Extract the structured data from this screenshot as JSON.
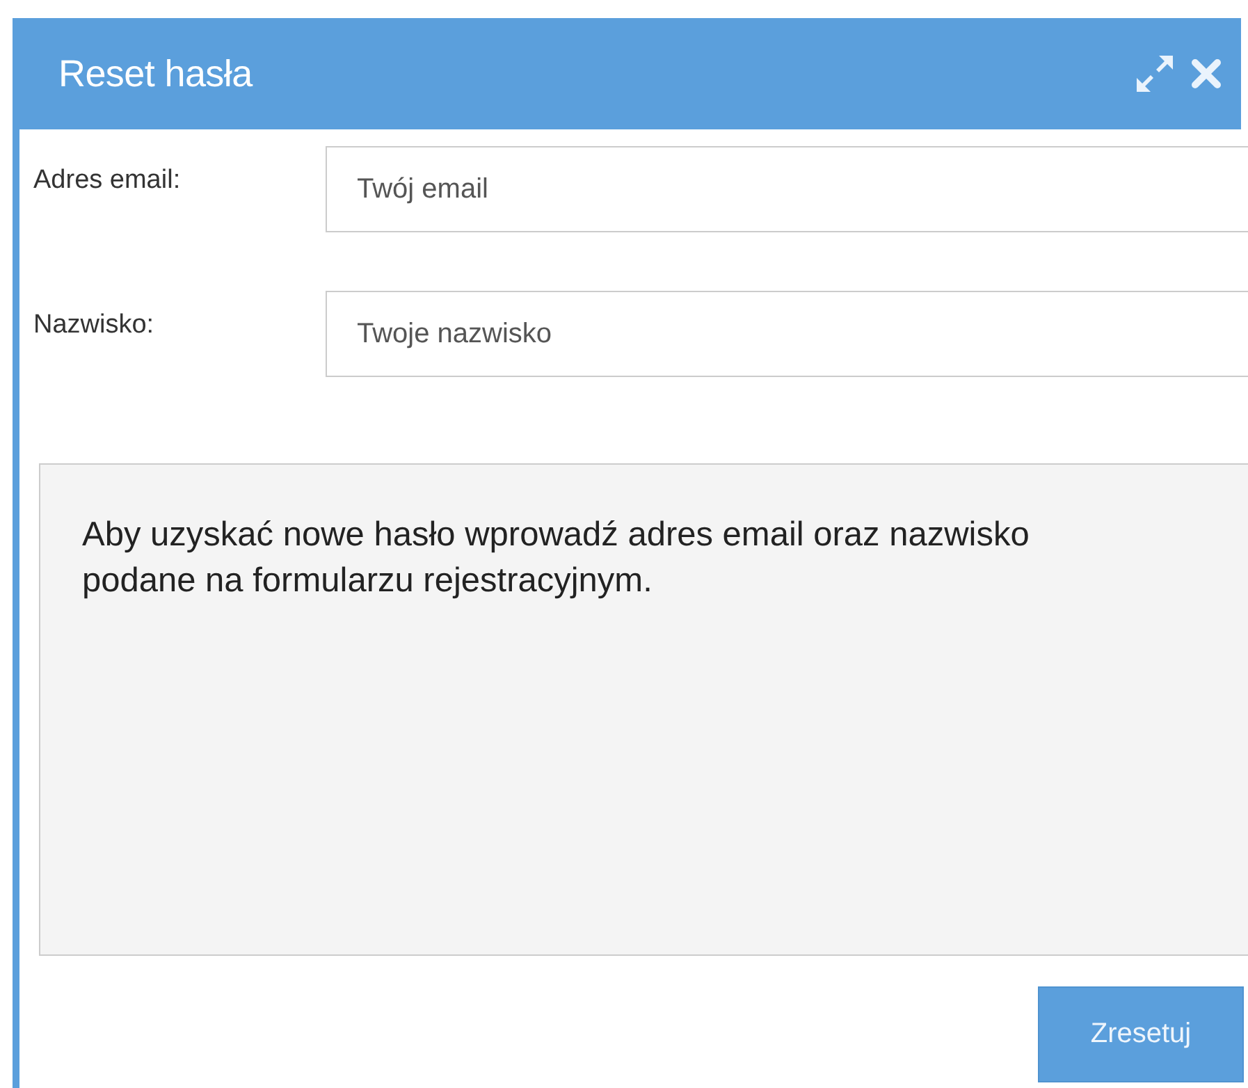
{
  "dialog": {
    "title": "Reset hasła",
    "fields": [
      {
        "label": "Adres email:",
        "placeholder": "Twój email"
      },
      {
        "label": "Nazwisko:",
        "placeholder": "Twoje nazwisko"
      }
    ],
    "info": "Aby uzyskać nowe hasło wprowadź adres email oraz nazwisko podane na formularzu rejestracyjnym.",
    "buttons": [
      "Zresetuj"
    ]
  }
}
